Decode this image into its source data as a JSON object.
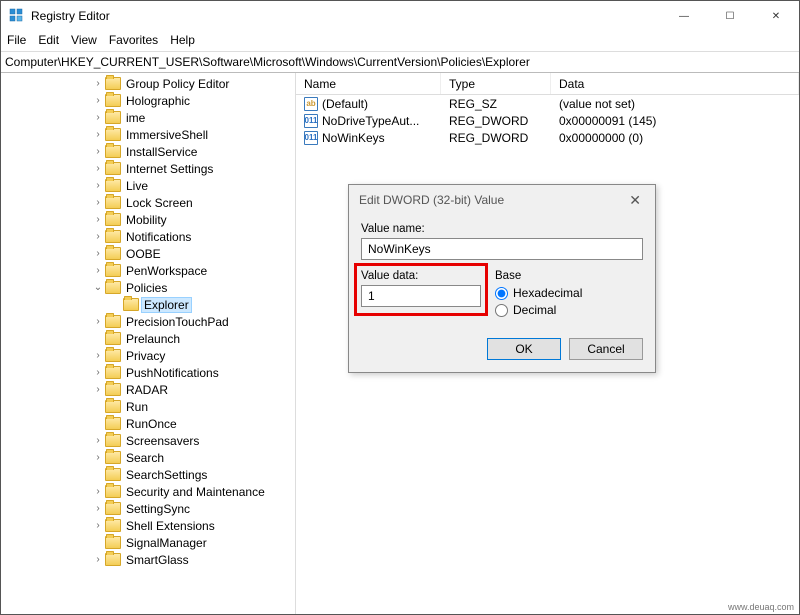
{
  "window": {
    "title": "Registry Editor",
    "controls": {
      "min": "—",
      "max": "☐",
      "close": "✕"
    }
  },
  "menu": [
    "File",
    "Edit",
    "View",
    "Favorites",
    "Help"
  ],
  "address": "Computer\\HKEY_CURRENT_USER\\Software\\Microsoft\\Windows\\CurrentVersion\\Policies\\Explorer",
  "tree": [
    {
      "label": "Group Policy Editor",
      "indent": 90,
      "exp": ">"
    },
    {
      "label": "Holographic",
      "indent": 90,
      "exp": ">"
    },
    {
      "label": "ime",
      "indent": 90,
      "exp": ">"
    },
    {
      "label": "ImmersiveShell",
      "indent": 90,
      "exp": ">"
    },
    {
      "label": "InstallService",
      "indent": 90,
      "exp": ">"
    },
    {
      "label": "Internet Settings",
      "indent": 90,
      "exp": ">"
    },
    {
      "label": "Live",
      "indent": 90,
      "exp": ">"
    },
    {
      "label": "Lock Screen",
      "indent": 90,
      "exp": ">"
    },
    {
      "label": "Mobility",
      "indent": 90,
      "exp": ">"
    },
    {
      "label": "Notifications",
      "indent": 90,
      "exp": ">"
    },
    {
      "label": "OOBE",
      "indent": 90,
      "exp": ">"
    },
    {
      "label": "PenWorkspace",
      "indent": 90,
      "exp": ">"
    },
    {
      "label": "Policies",
      "indent": 90,
      "exp": "v"
    },
    {
      "label": "Explorer",
      "indent": 108,
      "exp": "",
      "selected": true
    },
    {
      "label": "PrecisionTouchPad",
      "indent": 90,
      "exp": ">"
    },
    {
      "label": "Prelaunch",
      "indent": 90,
      "exp": ""
    },
    {
      "label": "Privacy",
      "indent": 90,
      "exp": ">"
    },
    {
      "label": "PushNotifications",
      "indent": 90,
      "exp": ">"
    },
    {
      "label": "RADAR",
      "indent": 90,
      "exp": ">"
    },
    {
      "label": "Run",
      "indent": 90,
      "exp": ""
    },
    {
      "label": "RunOnce",
      "indent": 90,
      "exp": ""
    },
    {
      "label": "Screensavers",
      "indent": 90,
      "exp": ">"
    },
    {
      "label": "Search",
      "indent": 90,
      "exp": ">"
    },
    {
      "label": "SearchSettings",
      "indent": 90,
      "exp": ""
    },
    {
      "label": "Security and Maintenance",
      "indent": 90,
      "exp": ">"
    },
    {
      "label": "SettingSync",
      "indent": 90,
      "exp": ">"
    },
    {
      "label": "Shell Extensions",
      "indent": 90,
      "exp": ">"
    },
    {
      "label": "SignalManager",
      "indent": 90,
      "exp": ""
    },
    {
      "label": "SmartGlass",
      "indent": 90,
      "exp": ">"
    }
  ],
  "list": {
    "headers": {
      "name": "Name",
      "type": "Type",
      "data": "Data"
    },
    "rows": [
      {
        "icon": "ab",
        "name": "(Default)",
        "type": "REG_SZ",
        "data": "(value not set)"
      },
      {
        "icon": "bin",
        "name": "NoDriveTypeAut...",
        "type": "REG_DWORD",
        "data": "0x00000091 (145)"
      },
      {
        "icon": "bin",
        "name": "NoWinKeys",
        "type": "REG_DWORD",
        "data": "0x00000000 (0)"
      }
    ]
  },
  "dialog": {
    "title": "Edit DWORD (32-bit) Value",
    "value_name_label": "Value name:",
    "value_name": "NoWinKeys",
    "value_data_label": "Value data:",
    "value_data": "1",
    "base_label": "Base",
    "radio_hex": "Hexadecimal",
    "radio_dec": "Decimal",
    "ok": "OK",
    "cancel": "Cancel"
  },
  "watermark": "www.deuaq.com"
}
